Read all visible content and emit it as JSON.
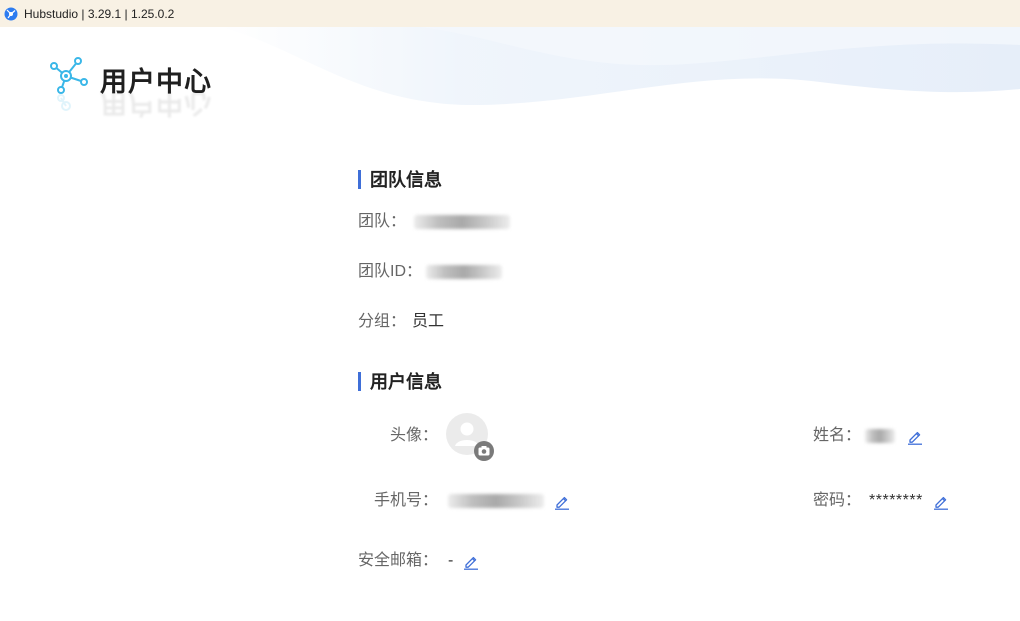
{
  "window": {
    "title": "Hubstudio | 3.29.1 | 1.25.0.2"
  },
  "page": {
    "title": "用户中心"
  },
  "team_section": {
    "heading": "团队信息",
    "team_label": "团队：",
    "team_id_label": "团队ID：",
    "group_label": "分组：",
    "group_value": "员工"
  },
  "user_section": {
    "heading": "用户信息",
    "avatar_label": "头像：",
    "name_label": "姓名：",
    "phone_label": "手机号：",
    "password_label": "密码：",
    "password_value": "********",
    "email_label": "安全邮箱：",
    "email_value": "-"
  },
  "icons": {
    "app": "hubstudio-logo-icon",
    "page_logo": "network-nodes-icon",
    "edit": "pencil-edit-icon",
    "avatar": "user-avatar-icon",
    "camera": "camera-icon"
  },
  "colors": {
    "accent": "#3f6fd8",
    "logo": "#3ab7e8",
    "titlebar": "#f8f1e4"
  }
}
